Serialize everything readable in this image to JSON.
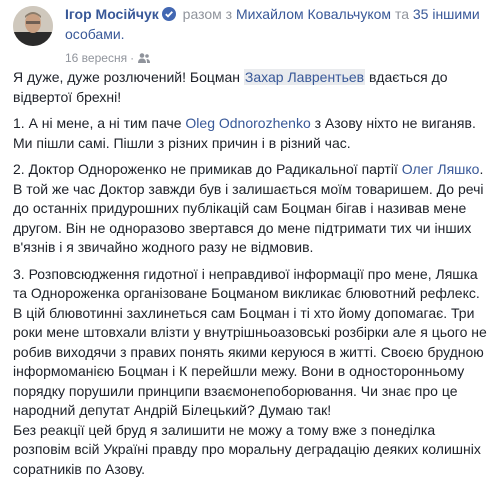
{
  "header": {
    "author": "Ігор Мосійчук",
    "with_prefix": "разом з",
    "with_person": "Михайлом Ковальчуком",
    "and": "та",
    "others": "35 іншими особами.",
    "date": "16 вересня",
    "verified_icon": "verified-badge-icon",
    "audience_icon": "friends-audience-icon"
  },
  "post": {
    "p1_a": "Я дуже, дуже розлючений! Боцман ",
    "p1_tag": "Захар Лаврентьев",
    "p1_b": " вдається до відвертої брехні!",
    "p2_a": "1. А ні мене, а ні тим паче ",
    "p2_tag": "Oleg Odnorozhenko",
    "p2_b": " з Азову ніхто не виганяв. Ми пішли самі. Пішли з різних причин і в різний час.",
    "p3_a": "2. Доктор Однороженко не примикав до Радикальної партії ",
    "p3_tag": "Олег Ляшко",
    "p3_b": ". В той же час Доктор завжди був і залишається моїм товаришем. До речі до останніх придурошних публікацій сам Боцман бігав і називав мене другом. Він не одноразово звертався до мене підтримати тих чи інших в'язнів і я звичайно жодного разу не відмовив.",
    "p4": "3. Розповсюдження гидотної і неправдивої інформації про мене, Ляшка та Однороженка організоване Боцманом викликає блювотний рефлекс. В цій блювотинні захлинеться сам Боцман і ті хто йому допомагає. Три роки мене штовхали влізти у внутрішньоазовські розбірки але я цього не робив виходячи з правих понять якими керуюся в житті. Своєю брудною інформоманією Боцман і К перейшли межу. Вони в односторонньому порядку порушили принципи взаємонепоборювання. Чи знає про це народний депутат Андрій Білецький? Думаю так!",
    "p5": "Без реакції цей бруд я залишити не можу а тому вже з понеділка розповім всій Україні правду про моральну деградацію деяких колишніх соратників по Азову."
  },
  "colors": {
    "link": "#385898",
    "text": "#1d2129",
    "meta": "#90949c"
  }
}
